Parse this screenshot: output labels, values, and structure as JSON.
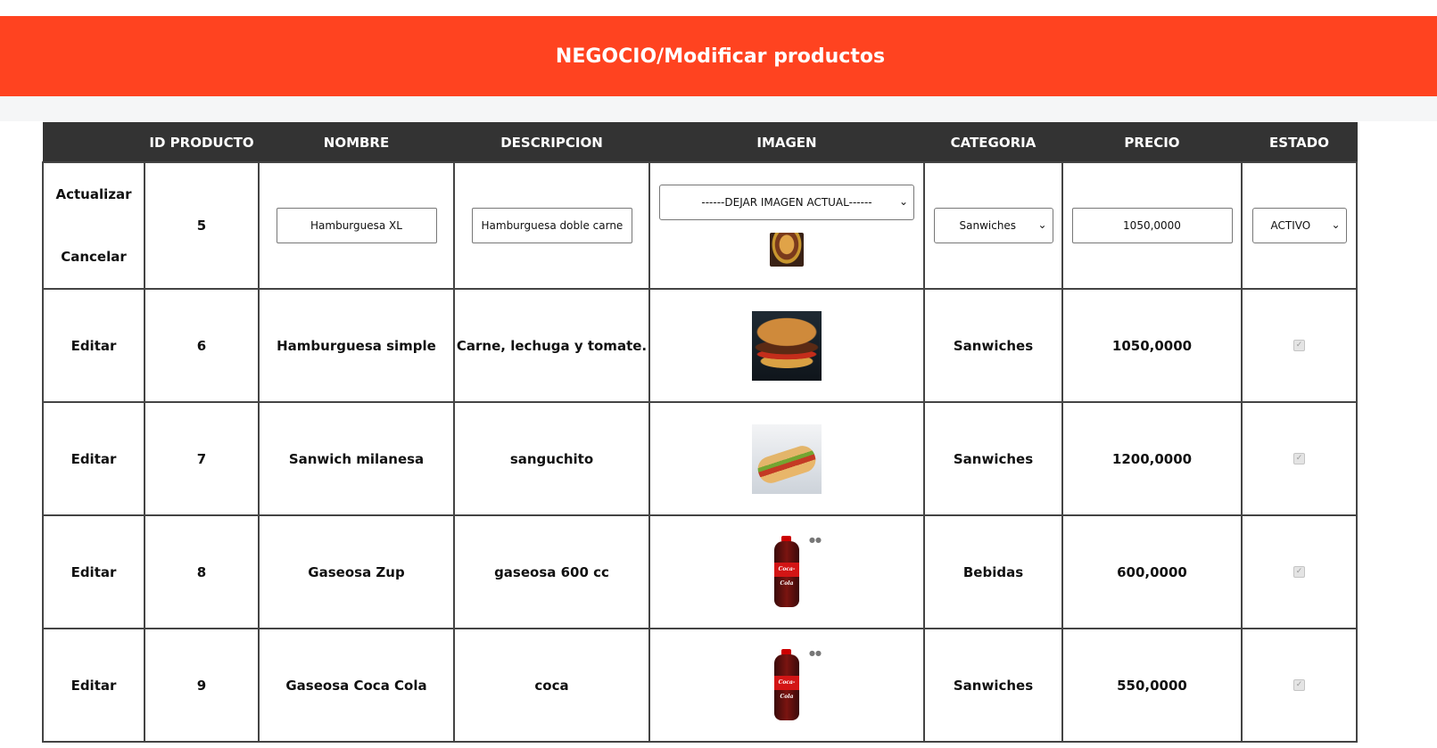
{
  "header": {
    "title": "NEGOCIO/Modificar productos"
  },
  "table": {
    "columns": [
      "",
      "ID PRODUCTO",
      "NOMBRE",
      "DESCRIPCION",
      "IMAGEN",
      "CATEGORIA",
      "PRECIO",
      "ESTADO"
    ],
    "edit_row": {
      "update_label": "Actualizar",
      "cancel_label": "Cancelar",
      "id": "5",
      "nombre_value": "Hamburguesa XL",
      "descripcion_value": "Hamburguesa doble carne",
      "imagen_option": "------DEJAR IMAGEN ACTUAL------",
      "categoria_value": "Sanwiches",
      "precio_value": "1050,0000",
      "estado_value": "ACTIVO"
    },
    "rows": [
      {
        "action": "Editar",
        "id": "6",
        "nombre": "Hamburguesa simple",
        "descripcion": "Carne, lechuga y tomate.",
        "image": "burger-photo",
        "categoria": "Sanwiches",
        "precio": "1050,0000",
        "estado_checked": true
      },
      {
        "action": "Editar",
        "id": "7",
        "nombre": "Sanwich milanesa",
        "descripcion": "sanguchito",
        "image": "sandwich-photo",
        "categoria": "Sanwiches",
        "precio": "1200,0000",
        "estado_checked": true
      },
      {
        "action": "Editar",
        "id": "8",
        "nombre": "Gaseosa Zup",
        "descripcion": "gaseosa 600 cc",
        "image": "cola-bottle-photo",
        "categoria": "Bebidas",
        "precio": "600,0000",
        "estado_checked": true
      },
      {
        "action": "Editar",
        "id": "9",
        "nombre": "Gaseosa Coca Cola",
        "descripcion": "coca",
        "image": "cola-bottle-photo",
        "categoria": "Sanwiches",
        "precio": "550,0000",
        "estado_checked": true
      }
    ]
  },
  "colors": {
    "header_bg": "#ff4320",
    "table_header_bg": "#333333"
  }
}
